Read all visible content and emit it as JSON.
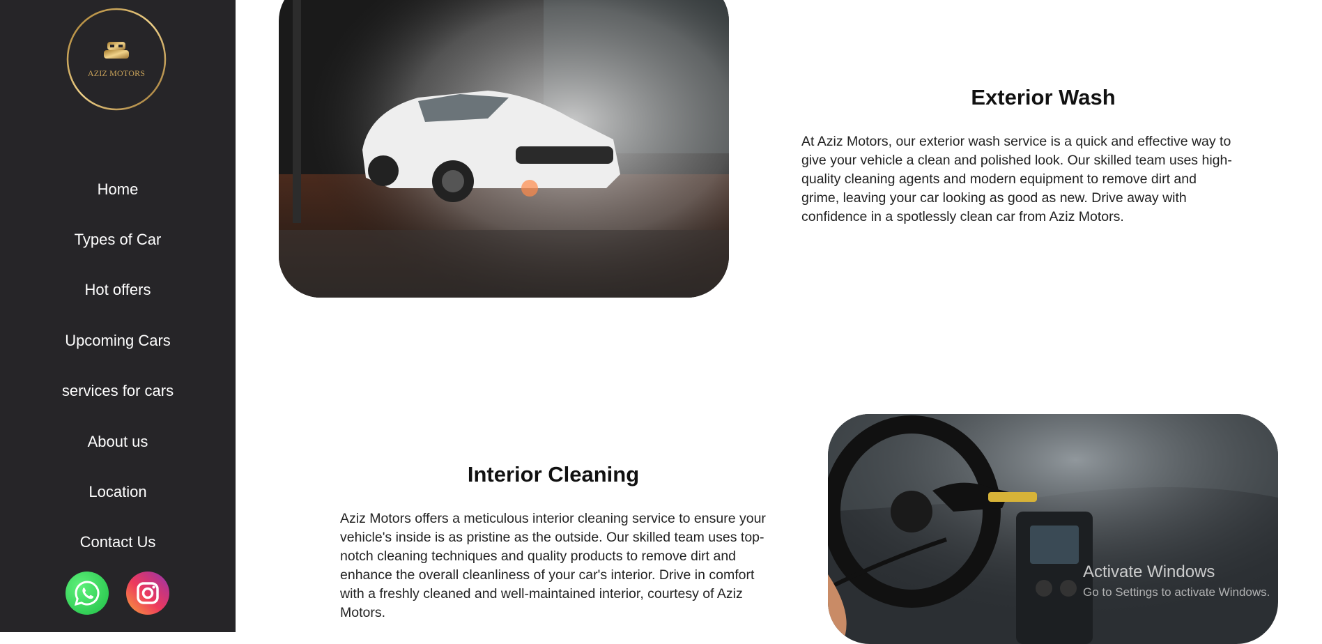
{
  "brand": {
    "logo_text": "AZIZ MOTORS"
  },
  "nav": [
    {
      "label": "Home"
    },
    {
      "label": "Types of Car"
    },
    {
      "label": "Hot offers"
    },
    {
      "label": "Upcoming Cars"
    },
    {
      "label": "services for cars"
    },
    {
      "label": "About us"
    },
    {
      "label": "Location"
    },
    {
      "label": "Contact Us"
    }
  ],
  "social": {
    "whatsapp_icon": "whatsapp-icon",
    "instagram_icon": "instagram-icon"
  },
  "services": [
    {
      "title": "Exterior Wash",
      "body": "At Aziz Motors, our exterior wash service is a quick and effective way to give your vehicle a clean and polished look. Our skilled team uses high-quality cleaning agents and modern equipment to remove dirt and grime, leaving your car looking as good as new. Drive away with confidence in a spotlessly clean car from Aziz Motors."
    },
    {
      "title": "Interior Cleaning",
      "body": "Aziz Motors offers a meticulous interior cleaning service to ensure your vehicle's inside is as pristine as the outside. Our skilled team uses top-notch cleaning techniques and quality products to remove dirt and enhance the overall cleanliness of your car's interior. Drive in comfort with a freshly cleaned and well-maintained interior, courtesy of Aziz Motors."
    }
  ],
  "os_watermark": {
    "title": "Activate Windows",
    "subtitle": "Go to Settings to activate Windows."
  },
  "colors": {
    "sidebar": "#262528",
    "gold": "#c9a35a"
  }
}
